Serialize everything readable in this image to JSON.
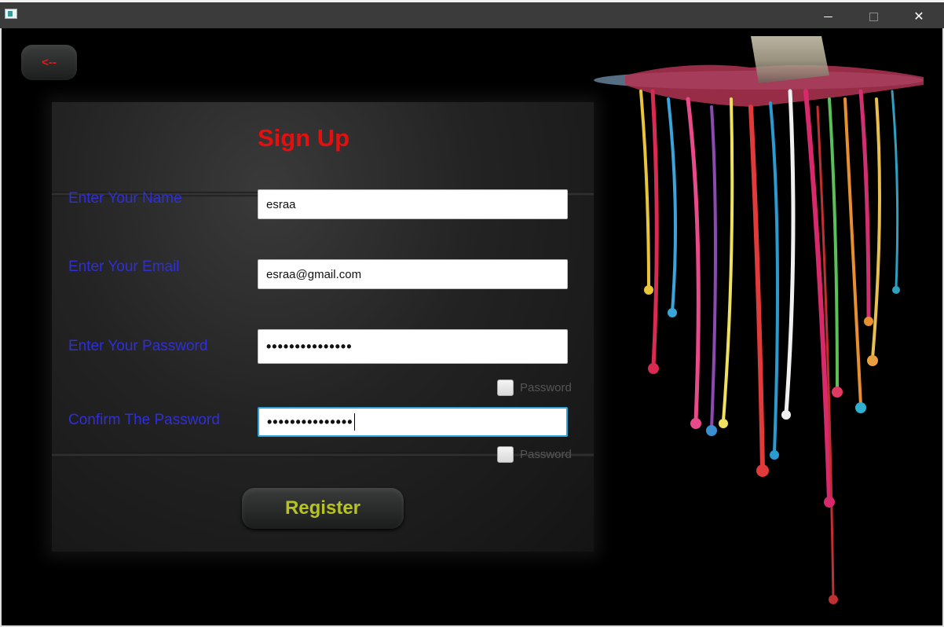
{
  "window": {
    "title": "",
    "minimize_glyph": "",
    "close_glyph": "✕"
  },
  "back_button": {
    "label": "<--"
  },
  "form": {
    "title": "Sign Up",
    "name_label": "Enter Your Name",
    "name_value": "esraa",
    "email_label": "Enter Your Email",
    "email_value": "esraa@gmail.com",
    "password_label": "Enter Your Password",
    "password_value": "•••••••••••••••",
    "show_password_label": "Password",
    "confirm_label": "Confirm The Password",
    "confirm_value": "•••••••••••••••",
    "show_confirm_label": "Password",
    "register_label": "Register"
  },
  "colors": {
    "title": "#e50f0f",
    "labels": "#2f2fd8",
    "register_text": "#b7c31f",
    "back_text": "#e01b1b"
  }
}
